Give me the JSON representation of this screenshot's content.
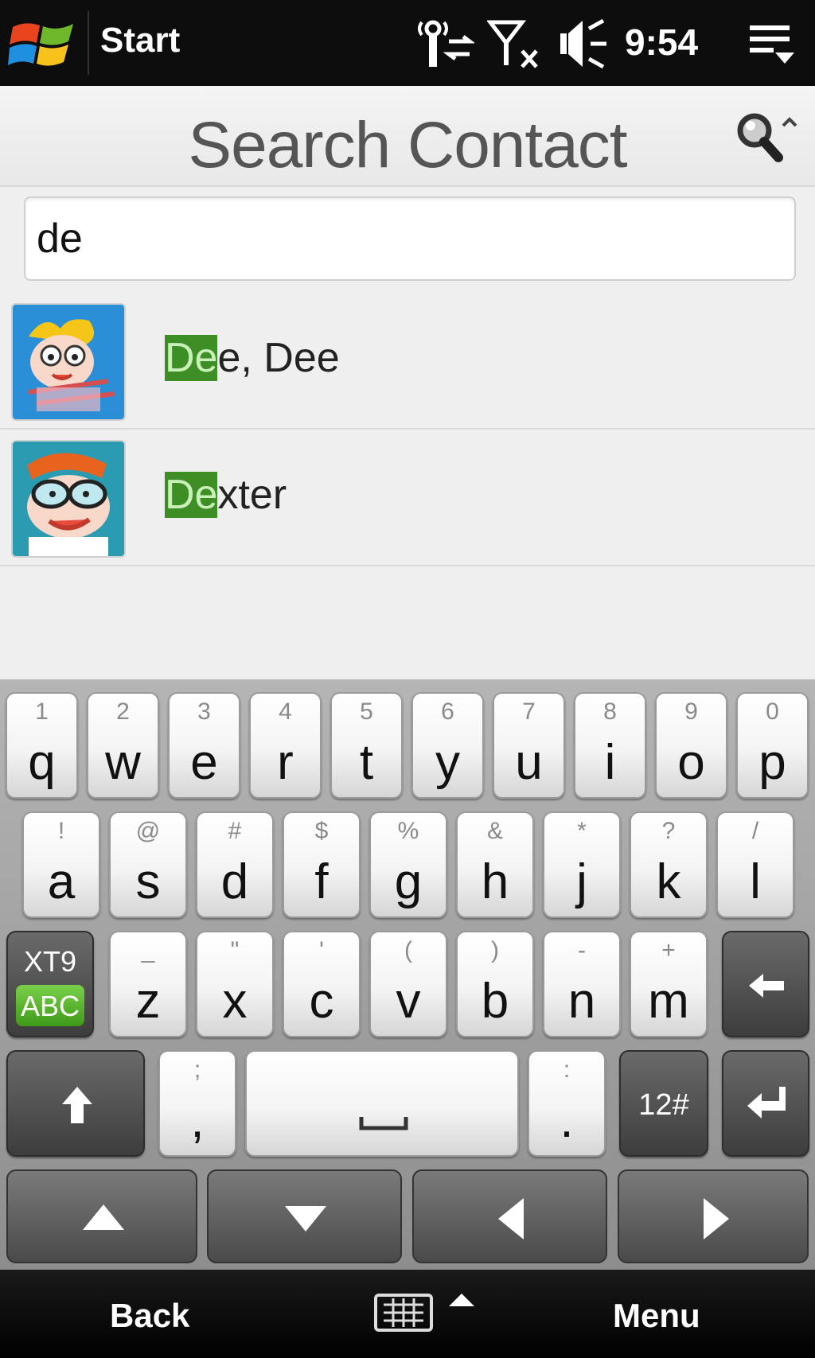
{
  "status_bar": {
    "app_title": "Start",
    "time": "9:54",
    "icons": [
      "windows-logo-icon",
      "data-connection-icon",
      "signal-no-service-icon",
      "volume-icon",
      "quick-menu-icon"
    ]
  },
  "header": {
    "title": "Search Contact",
    "search_icon": "magnifier-icon"
  },
  "search": {
    "value": "de",
    "placeholder": ""
  },
  "contacts": [
    {
      "match": "De",
      "rest": "e, Dee",
      "avatar": "dee-dee-avatar"
    },
    {
      "match": "De",
      "rest": "xter",
      "avatar": "dexter-avatar"
    }
  ],
  "highlight_color": "#3e8e26",
  "keyboard": {
    "row1": [
      {
        "sec": "1",
        "pri": "q"
      },
      {
        "sec": "2",
        "pri": "w"
      },
      {
        "sec": "3",
        "pri": "e"
      },
      {
        "sec": "4",
        "pri": "r"
      },
      {
        "sec": "5",
        "pri": "t"
      },
      {
        "sec": "6",
        "pri": "y"
      },
      {
        "sec": "7",
        "pri": "u"
      },
      {
        "sec": "8",
        "pri": "i"
      },
      {
        "sec": "9",
        "pri": "o"
      },
      {
        "sec": "0",
        "pri": "p"
      }
    ],
    "row2": [
      {
        "sec": "!",
        "pri": "a"
      },
      {
        "sec": "@",
        "pri": "s"
      },
      {
        "sec": "#",
        "pri": "d"
      },
      {
        "sec": "$",
        "pri": "f"
      },
      {
        "sec": "%",
        "pri": "g"
      },
      {
        "sec": "&",
        "pri": "h"
      },
      {
        "sec": "*",
        "pri": "j"
      },
      {
        "sec": "?",
        "pri": "k"
      },
      {
        "sec": "/",
        "pri": "l"
      }
    ],
    "row3": [
      {
        "sec": "_",
        "pri": "z"
      },
      {
        "sec": "\"",
        "pri": "x"
      },
      {
        "sec": "'",
        "pri": "c"
      },
      {
        "sec": "(",
        "pri": "v"
      },
      {
        "sec": ")",
        "pri": "b"
      },
      {
        "sec": "-",
        "pri": "n"
      },
      {
        "sec": "+",
        "pri": "m"
      }
    ],
    "mode_key_top": "XT9",
    "mode_key_bottom": "ABC",
    "semicolon_key": {
      "sec": ";",
      "pri": ","
    },
    "colon_key": {
      "sec": ":",
      "pri": "."
    },
    "numbers_key": "12#"
  },
  "bottom_bar": {
    "left_softkey": "Back",
    "right_softkey": "Menu"
  }
}
